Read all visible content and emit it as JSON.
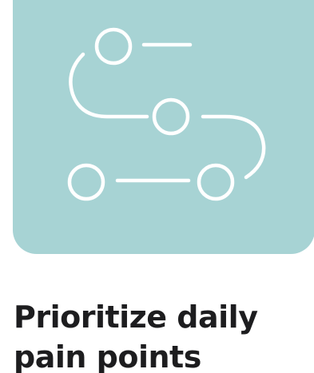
{
  "card": {
    "background_color": "#a7d3d4",
    "icon": "journey-path-icon",
    "icon_color": "#ffffff"
  },
  "headline": {
    "text": "Prioritize daily pain points"
  }
}
